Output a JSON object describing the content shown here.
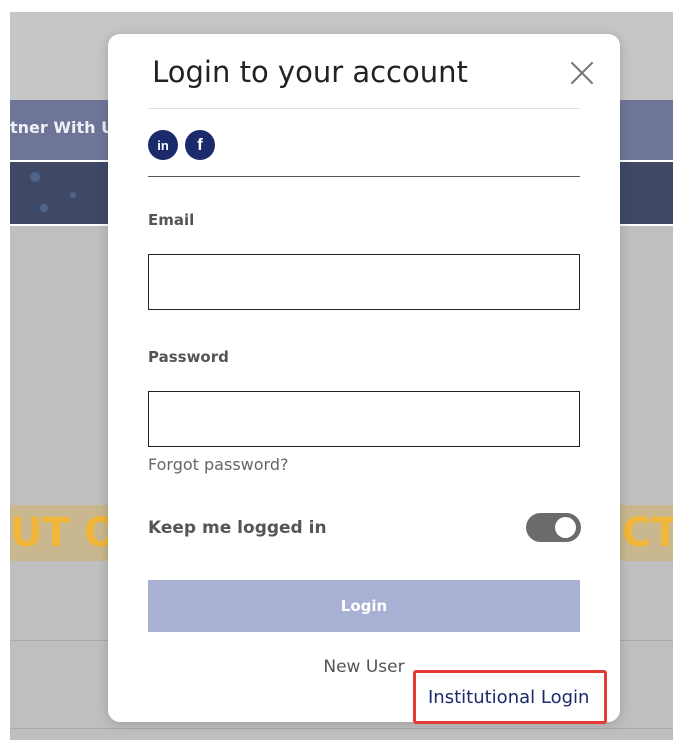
{
  "background": {
    "nav_partial_text": "tner With U",
    "banner_left_text": "UT O",
    "banner_right_text": "CT"
  },
  "modal": {
    "title": "Login to your account",
    "close_icon": "close-icon",
    "social": [
      {
        "name": "linkedin-icon",
        "label": "in"
      },
      {
        "name": "facebook-icon",
        "label": "f"
      }
    ],
    "email": {
      "label": "Email",
      "value": "",
      "placeholder": ""
    },
    "password": {
      "label": "Password",
      "value": "",
      "placeholder": ""
    },
    "forgot_password": "Forgot password?",
    "keep_logged_in": {
      "label": "Keep me logged in",
      "enabled": true
    },
    "login_button": "Login",
    "new_user": "New User",
    "institutional_login": "Institutional Login"
  },
  "colors": {
    "brand_navy": "#1b2a6b",
    "login_button": "#a8b0d4",
    "highlight_box": "#e53935",
    "toggle_track": "#6b6b6b"
  }
}
